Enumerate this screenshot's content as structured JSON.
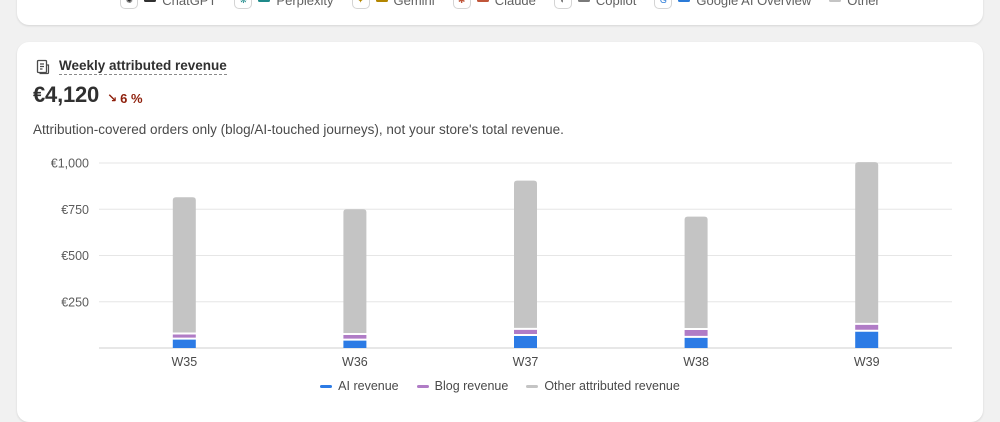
{
  "top_legend": [
    {
      "label": "ChatGPT",
      "color": "#303030",
      "icon": "chatgpt-icon",
      "glyph": "✺"
    },
    {
      "label": "Perplexity",
      "color": "#1f8a8a",
      "icon": "perplexity-icon",
      "glyph": "❋"
    },
    {
      "label": "Gemini",
      "color": "#b38600",
      "icon": "gemini-icon",
      "glyph": "✦"
    },
    {
      "label": "Claude",
      "color": "#c0563a",
      "icon": "claude-icon",
      "glyph": "✱"
    },
    {
      "label": "Copilot",
      "color": "#7a7a7a",
      "icon": "copilot-icon",
      "glyph": "◐"
    },
    {
      "label": "Google AI Overview",
      "color": "#2b7bd8",
      "icon": "google-icon",
      "glyph": "G"
    },
    {
      "label": "Other",
      "color": "#c4c4c4",
      "icon": "",
      "glyph": ""
    }
  ],
  "card": {
    "title": "Weekly attributed revenue",
    "value": "€4,120",
    "delta": "6 %",
    "delta_arrow": "↘",
    "note": "Attribution-covered orders only (blog/AI-touched journeys), not your store's total revenue."
  },
  "chart_data": {
    "type": "bar",
    "stacked": true,
    "categories": [
      "W35",
      "W36",
      "W37",
      "W38",
      "W39"
    ],
    "series": [
      {
        "name": "AI revenue",
        "color": "#2c7be5",
        "values": [
          45,
          40,
          65,
          55,
          88
        ]
      },
      {
        "name": "Blog revenue",
        "color": "#b07cc6",
        "values": [
          28,
          30,
          33,
          42,
          37
        ]
      },
      {
        "name": "Other attributed revenue",
        "color": "#c4c4c4",
        "values": [
          742,
          680,
          807,
          613,
          880
        ]
      }
    ],
    "ylim": [
      0,
      1000
    ],
    "yticks": [
      0,
      250,
      500,
      750,
      1000
    ],
    "ytick_labels": [
      "",
      "€250",
      "€500",
      "€750",
      "€1,000"
    ],
    "grid": true,
    "legend_position": "bottom"
  }
}
